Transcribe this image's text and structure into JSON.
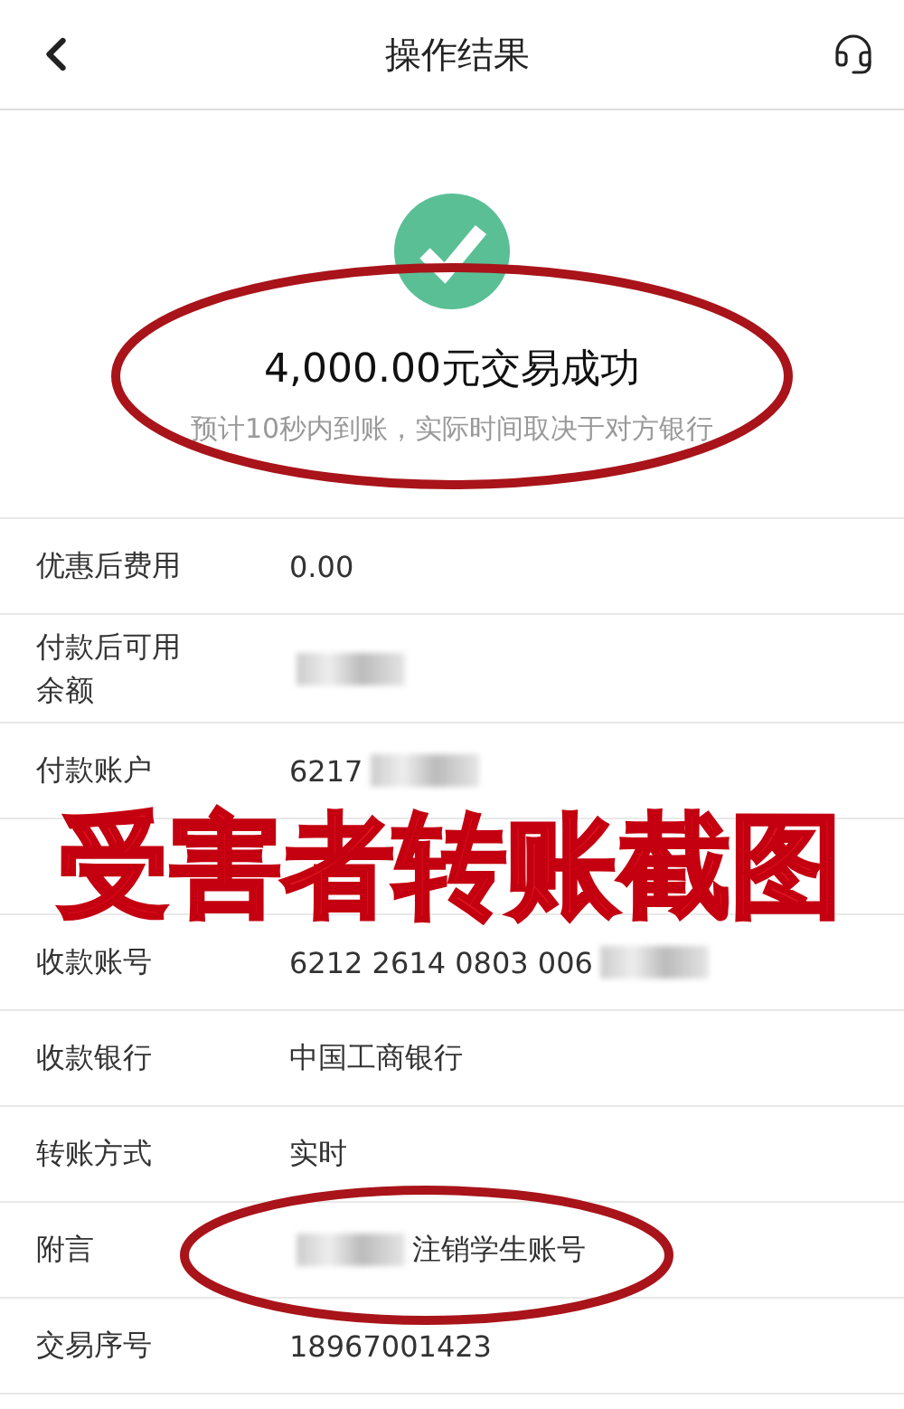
{
  "header": {
    "title": "操作结果"
  },
  "result": {
    "amount_status": "4,000.00元交易成功",
    "note": "预计10秒内到账，实际时间取决于对方银行"
  },
  "rows": [
    {
      "label": "优惠后费用",
      "value": "0.00"
    },
    {
      "label": "付款后可用余额",
      "redacted_after": true
    },
    {
      "label": "付款账户",
      "value": "6217",
      "redacted_after": true
    },
    {
      "label": "收款账号",
      "value": "6212 2614 0803 006",
      "redacted_after": true
    },
    {
      "label": "收款银行",
      "value": "中国工商银行"
    },
    {
      "label": "转账方式",
      "value": "实时"
    },
    {
      "label": "附言",
      "value": "注销学生账号",
      "redacted_before": true
    },
    {
      "label": "交易序号",
      "value": "18967001423"
    }
  ],
  "annotations": [
    {
      "kind": "ellipse"
    },
    {
      "kind": "ellipse"
    },
    {
      "kind": "caption",
      "text": "受害者转账截图"
    }
  ]
}
